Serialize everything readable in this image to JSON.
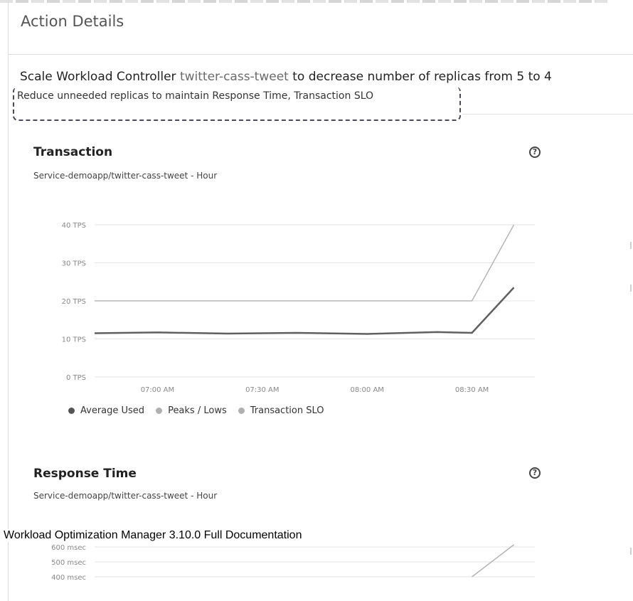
{
  "header": {
    "title": "Action Details"
  },
  "action": {
    "prefix": "Scale Workload Controller ",
    "entity": "twitter-cass-tweet",
    "suffix": " to decrease number of replicas from 5 to 4",
    "reason": "Reduce unneeded replicas to maintain Response Time, Transaction SLO"
  },
  "transaction_chart": {
    "title": "Transaction",
    "subtitle": "Service-demoapp/twitter-cass-tweet - Hour",
    "help_icon": "question-circle-icon",
    "legend": [
      {
        "label": "Average Used",
        "color": "#555555"
      },
      {
        "label": "Peaks / Lows",
        "color": "#b0b0b0"
      },
      {
        "label": "Transaction SLO",
        "color": "#b0b0b0"
      }
    ]
  },
  "response_chart": {
    "title": "Response Time",
    "subtitle": "Service-demoapp/twitter-cass-tweet - Hour",
    "help_icon": "question-circle-icon"
  },
  "footer": {
    "text": "Workload Optimization Manager 3.10.0 Full Documentation"
  },
  "chart_data": [
    {
      "type": "line",
      "title": "Transaction",
      "subtitle": "Service-demoapp/twitter-cass-tweet - Hour",
      "y_tick_labels": [
        "0 TPS",
        "10 TPS",
        "20 TPS",
        "30 TPS",
        "40 TPS"
      ],
      "ylim": [
        0,
        40
      ],
      "x_tick_labels": [
        "07:00 AM",
        "07:30 AM",
        "08:00 AM",
        "08:30 AM"
      ],
      "x_minutes": [
        0,
        30,
        60,
        90
      ],
      "x_domain_minutes": [
        -18,
        108
      ],
      "grid": true,
      "legend_position": "bottom",
      "series": [
        {
          "name": "Average Used",
          "color": "#606060",
          "x": [
            -18,
            0,
            20,
            40,
            60,
            80,
            90,
            102
          ],
          "y": [
            11.5,
            11.7,
            11.4,
            11.6,
            11.3,
            11.8,
            11.6,
            23.5
          ]
        },
        {
          "name": "Transaction SLO",
          "color": "#b5b5b5",
          "x": [
            -18,
            90,
            102
          ],
          "y": [
            20,
            20,
            40
          ]
        }
      ]
    },
    {
      "type": "line",
      "title": "Response Time",
      "subtitle": "Service-demoapp/twitter-cass-tweet - Hour",
      "y_tick_labels": [
        "400 msec",
        "500 msec",
        "600 msec"
      ],
      "ylim": [
        400,
        600
      ],
      "grid": true,
      "series": [
        {
          "color": "#b5b5b5",
          "x": [
            90,
            102
          ],
          "y": [
            400,
            615
          ]
        }
      ]
    }
  ]
}
